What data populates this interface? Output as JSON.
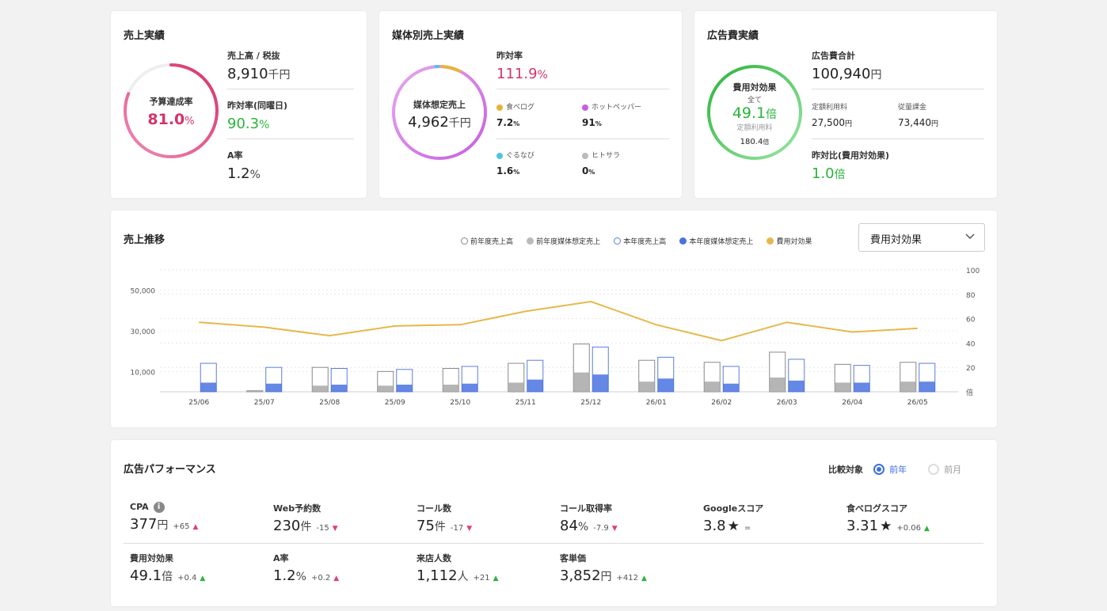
{
  "sales": {
    "title": "売上実績",
    "gauge_label": "予算達成率",
    "gauge_value": "81.0",
    "gauge_unit": "%",
    "gauge_fraction": 0.81,
    "sales_label": "売上高 / 税抜",
    "sales_value": "8,910",
    "sales_unit": "千円",
    "yoy_label": "昨対率(同曜日)",
    "yoy_value": "90.3",
    "yoy_unit": "%",
    "a_label": "A率",
    "a_value": "1.2",
    "a_unit": "%"
  },
  "media": {
    "title": "媒体別売上実績",
    "gauge_label": "媒体想定売上",
    "gauge_value": "4,962",
    "gauge_unit": "千円",
    "yoy_label": "昨対率",
    "yoy_value": "111.9",
    "yoy_unit": "%",
    "items": [
      {
        "name": "食べログ",
        "value": "7.2",
        "unit": "%",
        "color": "#e8b33a"
      },
      {
        "name": "ホットペッパー",
        "value": "91",
        "unit": "%",
        "color": "#c75ee0"
      },
      {
        "name": "ぐるなび",
        "value": "1.6",
        "unit": "%",
        "color": "#4fc3e8"
      },
      {
        "name": "ヒトサラ",
        "value": "0",
        "unit": "%",
        "color": "#bbbbbb"
      }
    ]
  },
  "ad": {
    "title": "広告費実績",
    "gauge_label": "費用対効果",
    "gauge_sub": "全て",
    "gauge_value": "49.1",
    "gauge_unit": "倍",
    "gauge_sub2": "定額利用料",
    "gauge_sub2_value": "180.4",
    "gauge_sub2_unit": "倍",
    "total_label": "広告費合計",
    "total_value": "100,940",
    "total_unit": "円",
    "fixed_label": "定額利用料",
    "fixed_value": "27,500",
    "fixed_unit": "円",
    "usage_label": "従量課金",
    "usage_value": "73,440",
    "usage_unit": "円",
    "yoy_label": "昨対比(費用対効果)",
    "yoy_value": "1.0",
    "yoy_unit": "倍"
  },
  "trend": {
    "title": "売上推移",
    "legend": [
      {
        "label": "前年度売上高",
        "style": "outline-gray"
      },
      {
        "label": "前年度媒体想定売上",
        "style": "fill-gray"
      },
      {
        "label": "本年度売上高",
        "style": "outline-blue"
      },
      {
        "label": "本年度媒体想定売上",
        "style": "fill-blue"
      },
      {
        "label": "費用対効果",
        "style": "fill-gold"
      }
    ],
    "select_value": "費用対効果"
  },
  "chart_data": {
    "type": "bar",
    "categories": [
      "25/06",
      "25/07",
      "25/08",
      "25/09",
      "25/10",
      "25/11",
      "25/12",
      "26/01",
      "26/02",
      "26/03",
      "26/04",
      "26/05"
    ],
    "y_ticks": [
      "10,000",
      "30,000",
      "50,000"
    ],
    "y_tick_values": [
      10000,
      30000,
      50000
    ],
    "y2_ticks": [
      "倍",
      "20",
      "40",
      "60",
      "80",
      "100"
    ],
    "y2_tick_values": [
      0,
      20,
      40,
      60,
      80,
      100
    ],
    "ylim": [
      0,
      60000
    ],
    "y2lim": [
      0,
      100
    ],
    "grid": true,
    "series": [
      {
        "name": "前年度売上高",
        "values": [
          0,
          500,
          12000,
          10000,
          11500,
          14000,
          23500,
          15500,
          14500,
          19500,
          13500,
          14500
        ]
      },
      {
        "name": "前年度媒体想定売上",
        "values": [
          0,
          500,
          3000,
          3000,
          3500,
          4500,
          9500,
          5000,
          5000,
          7000,
          4500,
          5000
        ]
      },
      {
        "name": "本年度売上高",
        "values": [
          14000,
          12000,
          11500,
          11000,
          12500,
          15500,
          22000,
          17000,
          12500,
          16000,
          13000,
          14000
        ]
      },
      {
        "name": "本年度媒体想定売上",
        "values": [
          4500,
          4000,
          3500,
          3500,
          4000,
          6000,
          8500,
          6500,
          4000,
          5500,
          4500,
          5000
        ]
      },
      {
        "name": "費用対効果",
        "type": "line",
        "values": [
          57,
          53,
          46,
          54,
          55,
          66,
          74,
          55,
          42,
          57,
          49,
          52
        ]
      }
    ],
    "colors": {
      "prev_outline": "#888888",
      "prev_fill": "#a8a8a8",
      "cur_outline": "#5a7ed8",
      "cur_fill": "#4a72e0",
      "line": "#e6b84a"
    }
  },
  "perf": {
    "title": "広告パフォーマンス",
    "compare_label": "比較対象",
    "options": [
      {
        "label": "前年",
        "selected": true
      },
      {
        "label": "前月",
        "selected": false
      }
    ],
    "items": [
      {
        "label": "CPA",
        "value": "377",
        "unit": "円",
        "delta": "+65",
        "dir": "up",
        "good": false,
        "info": true
      },
      {
        "label": "Web予約数",
        "value": "230",
        "unit": "件",
        "delta": "-15",
        "dir": "down",
        "good": false
      },
      {
        "label": "コール数",
        "value": "75",
        "unit": "件",
        "delta": "-17",
        "dir": "down",
        "good": false
      },
      {
        "label": "コール取得率",
        "value": "84",
        "unit": "%",
        "delta": "-7.9",
        "dir": "down",
        "good": false
      },
      {
        "label": "Googleスコア",
        "value": "3.8",
        "unit": "★",
        "delta": "=",
        "dir": "none",
        "good": true
      },
      {
        "label": "食べログスコア",
        "value": "3.31",
        "unit": "★",
        "delta": "+0.06",
        "dir": "up",
        "good": true
      },
      {
        "label": "費用対効果",
        "value": "49.1",
        "unit": "倍",
        "delta": "+0.4",
        "dir": "up",
        "good": true
      },
      {
        "label": "A率",
        "value": "1.2",
        "unit": "%",
        "delta": "+0.2",
        "dir": "up",
        "good": false
      },
      {
        "label": "来店人数",
        "value": "1,112",
        "unit": "人",
        "delta": "+21",
        "dir": "up",
        "good": true
      },
      {
        "label": "客単価",
        "value": "3,852",
        "unit": "円",
        "delta": "+412",
        "dir": "up",
        "good": true
      }
    ]
  }
}
